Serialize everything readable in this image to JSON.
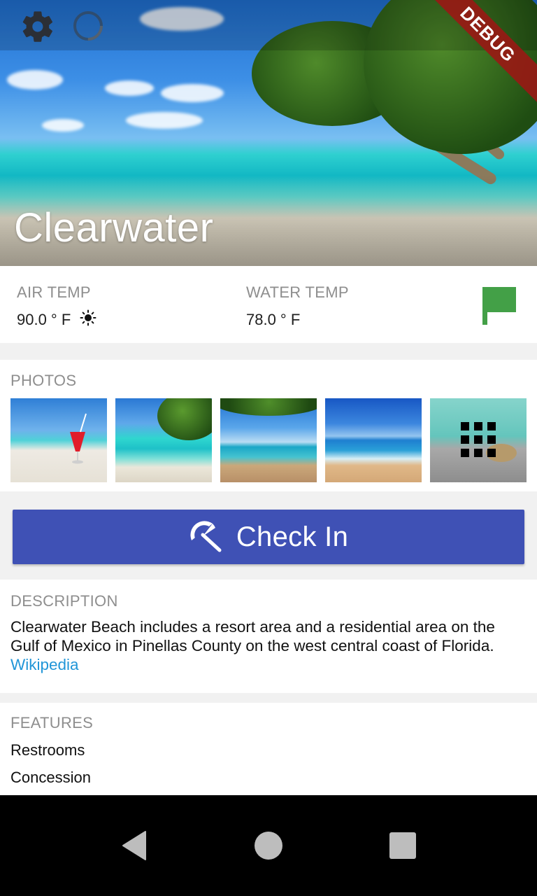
{
  "hero": {
    "title": "Clearwater",
    "debug_banner": "DEBUG"
  },
  "conditions": {
    "air_temp_label": "AIR TEMP",
    "air_temp_value": "90.0 ° F",
    "water_temp_label": "WATER TEMP",
    "water_temp_value": "78.0 ° F",
    "weather_icon": "sun-icon",
    "flag_icon": "flag-icon",
    "flag_color": "#43a047"
  },
  "photos": {
    "label": "PHOTOS",
    "items": [
      "beach-drink-photo",
      "palm-beach-photo",
      "shoreline-photo",
      "waves-photo",
      "blurred-photo-more"
    ],
    "more_icon": "grid-icon"
  },
  "checkin": {
    "label": "Check In",
    "icon": "beach-umbrella-icon",
    "color": "#3f51b5"
  },
  "description": {
    "label": "DESCRIPTION",
    "text": "Clearwater Beach includes a resort area and a residential area on the Gulf of Mexico in Pinellas County on the west central coast of Florida. ",
    "link_text": "Wikipedia",
    "link_color": "#2196d8"
  },
  "features": {
    "label": "FEATURES",
    "items": [
      "Restrooms",
      "Concession"
    ]
  },
  "navbar": {
    "back_icon": "back-icon",
    "home_icon": "home-icon",
    "recent_icon": "recent-apps-icon"
  }
}
